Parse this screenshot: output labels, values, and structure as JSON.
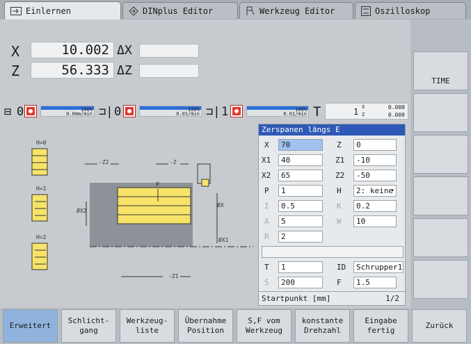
{
  "tabs": [
    {
      "label": "Einlernen",
      "icon": "teach-in-icon",
      "active": true
    },
    {
      "label": "DINplus Editor",
      "icon": "dinplus-editor-icon",
      "active": false
    },
    {
      "label": "Werkzeug Editor",
      "icon": "tool-editor-icon",
      "active": false
    },
    {
      "label": "Oszilloskop",
      "icon": "oscilloscope-icon",
      "active": false
    }
  ],
  "position": {
    "x_label": "X",
    "x_value": "10.002",
    "dx_label": "ΔX",
    "z_label": "Z",
    "z_value": "56.333",
    "dz_label": "ΔZ"
  },
  "status": {
    "spindle0": {
      "index": "0",
      "pct": "100%",
      "feed": "0.0mm/min"
    },
    "spindle0b": {
      "index": "0",
      "pct": "100%",
      "feed": "0.01/min"
    },
    "spindle1": {
      "index": "1",
      "pct": "100%",
      "feed": "0.01/min"
    },
    "tool_label": "T",
    "tool_index": "1",
    "tool_x": "0.000",
    "tool_z": "0.000",
    "tool_x_label": "X",
    "tool_z_label": "Z"
  },
  "drawing": {
    "h0": "H=0",
    "h1": "H=1",
    "h2": "H=2",
    "z2": "-Z2",
    "z": "-Z",
    "p": "P",
    "x2": "ØX2",
    "x": "ØX",
    "x1": "ØX1",
    "z1": "-Z1"
  },
  "form": {
    "title": "Zerspanen längs E",
    "rows": [
      {
        "l1": "X",
        "v1": "70",
        "l2": "Z",
        "v2": "0"
      },
      {
        "l1": "X1",
        "v1": "40",
        "l2": "Z1",
        "v2": "-10"
      },
      {
        "l1": "X2",
        "v1": "65",
        "l2": "Z2",
        "v2": "-50"
      },
      {
        "l1": "P",
        "v1": "1",
        "l2": "H",
        "v2": "2: keine"
      },
      {
        "l1": "I",
        "v1": "0.5",
        "l2": "K",
        "v2": "0.2"
      },
      {
        "l1": "A",
        "v1": "5",
        "l2": "W",
        "v2": "10"
      },
      {
        "l1": "R",
        "v1": "2"
      },
      {
        "l1": "T",
        "v1": "1",
        "l2": "ID",
        "v2": "Schrupper1"
      },
      {
        "l1": "S",
        "v1": "200",
        "l2": "F",
        "v2": "1.5"
      }
    ],
    "footer": "Startpunkt [mm]",
    "page": "1/2"
  },
  "vkeys": [
    "TIME",
    "",
    "",
    "",
    "",
    ""
  ],
  "hkeys": [
    "Erweitert",
    "Schlicht-\ngang",
    "Werkzeug-\nliste",
    "Übernahme\nPosition",
    "S,F vom\nWerkzeug",
    "konstante\nDrehzahl",
    "Eingabe\nfertig",
    "Zurück"
  ],
  "colors": {
    "accent": "#2f59b6",
    "highlight": "#9fc2f0",
    "alarm": "#e8372f",
    "progress": "#2d6fd6"
  }
}
